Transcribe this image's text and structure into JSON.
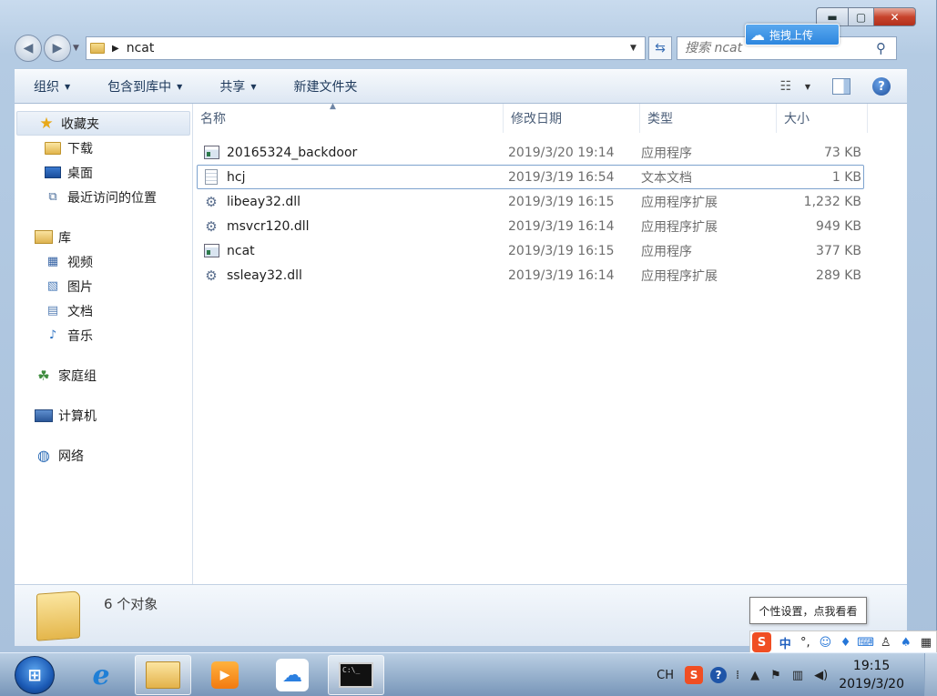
{
  "window": {
    "caption": {
      "minimize": "▬",
      "maximize": "▢",
      "close": "✕"
    }
  },
  "address": {
    "path": "ncat",
    "search_placeholder": "搜索 ncat"
  },
  "upload_widget": {
    "label": "拖拽上传"
  },
  "toolbar": {
    "organize": "组织",
    "include_library": "包含到库中",
    "share": "共享",
    "new_folder": "新建文件夹"
  },
  "sidebar": {
    "favorites": {
      "label": "收藏夹",
      "items": [
        {
          "label": "下载"
        },
        {
          "label": "桌面"
        },
        {
          "label": "最近访问的位置"
        }
      ]
    },
    "libraries": {
      "label": "库",
      "items": [
        {
          "label": "视频"
        },
        {
          "label": "图片"
        },
        {
          "label": "文档"
        },
        {
          "label": "音乐"
        }
      ]
    },
    "homegroup": {
      "label": "家庭组"
    },
    "computer": {
      "label": "计算机"
    },
    "network": {
      "label": "网络"
    }
  },
  "columns": {
    "name": "名称",
    "date": "修改日期",
    "type": "类型",
    "size": "大小"
  },
  "files": [
    {
      "name": "20165324_backdoor",
      "date": "2019/3/20 19:14",
      "type": "应用程序",
      "size": "73 KB",
      "icon": "exe-icon"
    },
    {
      "name": "hcj",
      "date": "2019/3/19 16:54",
      "type": "文本文档",
      "size": "1 KB",
      "icon": "text-file-icon"
    },
    {
      "name": "libeay32.dll",
      "date": "2019/3/19 16:15",
      "type": "应用程序扩展",
      "size": "1,232 KB",
      "icon": "dll-icon"
    },
    {
      "name": "msvcr120.dll",
      "date": "2019/3/19 16:14",
      "type": "应用程序扩展",
      "size": "949 KB",
      "icon": "dll-icon"
    },
    {
      "name": "ncat",
      "date": "2019/3/19 16:15",
      "type": "应用程序",
      "size": "377 KB",
      "icon": "exe-icon"
    },
    {
      "name": "ssleay32.dll",
      "date": "2019/3/19 16:14",
      "type": "应用程序扩展",
      "size": "289 KB",
      "icon": "dll-icon"
    }
  ],
  "details": {
    "count": "6 个对象"
  },
  "tooltip": {
    "text": "个性设置，点我看看"
  },
  "ime": {
    "mode": "中"
  },
  "taskbar": {
    "lang": "CH",
    "time": "19:15",
    "date": "2019/3/20"
  }
}
